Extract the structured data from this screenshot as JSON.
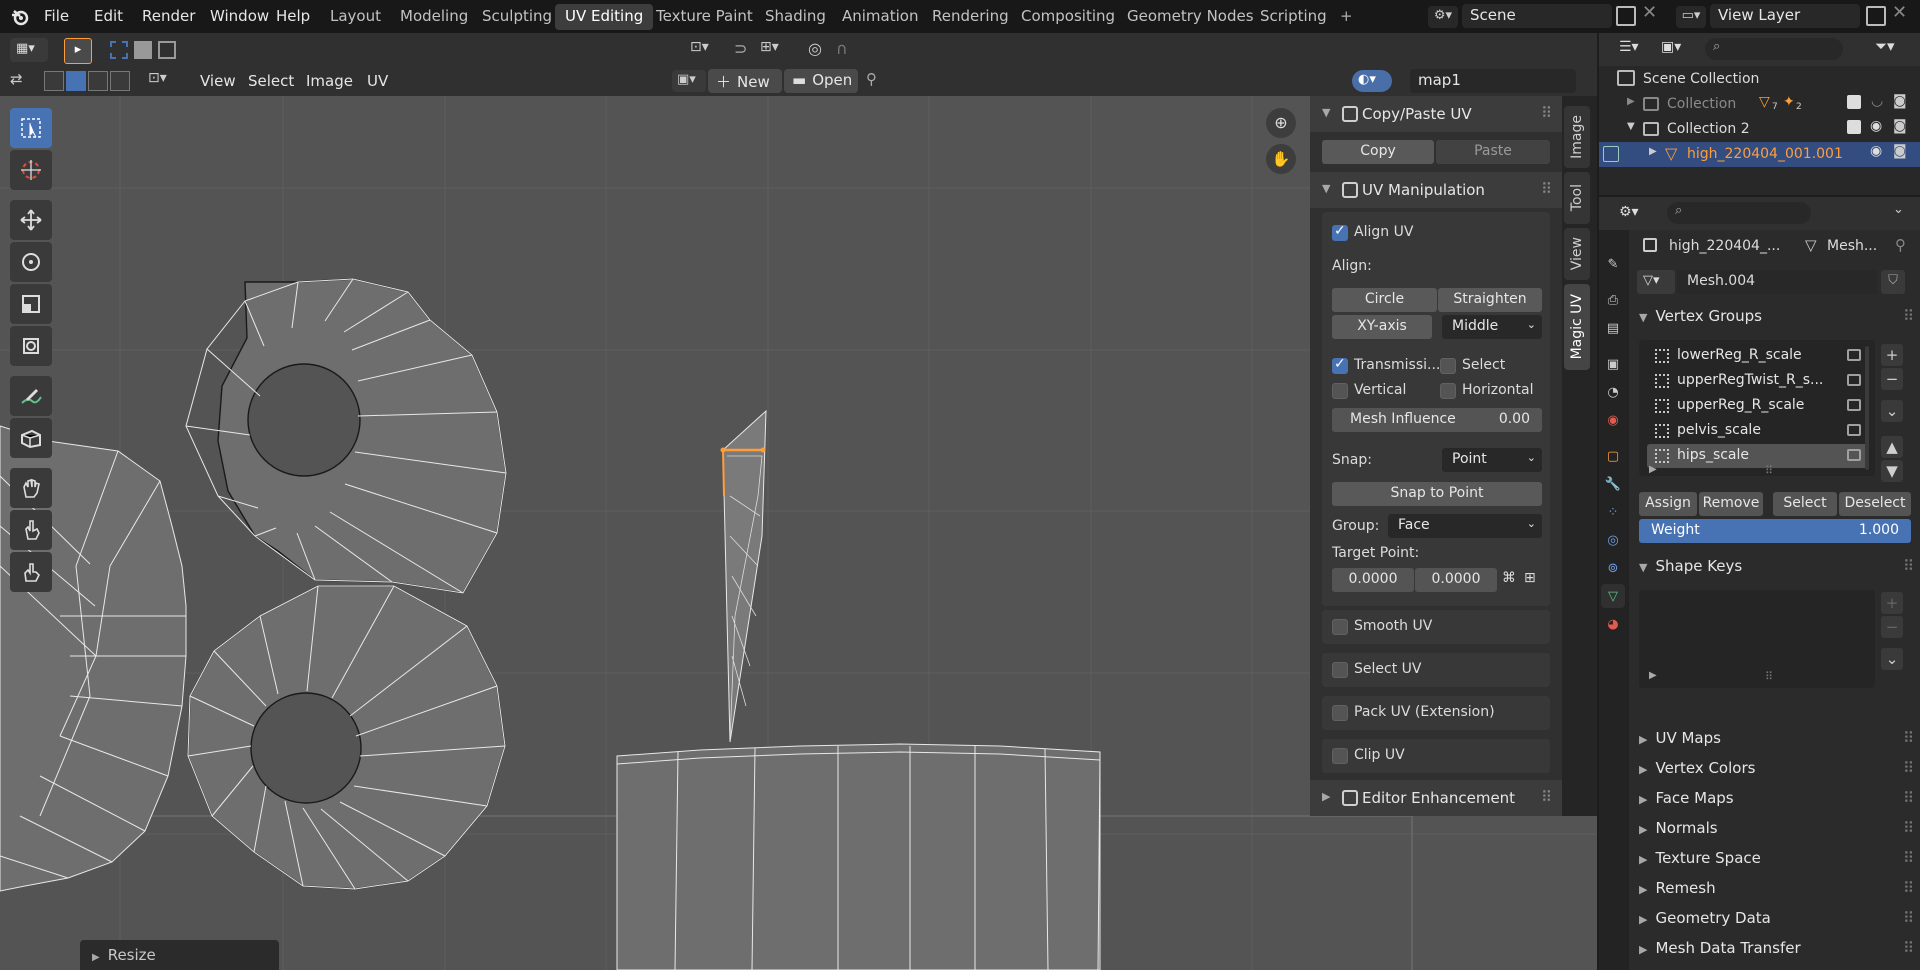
{
  "topbar": {
    "menus": [
      "File",
      "Edit",
      "Render",
      "Window",
      "Help"
    ],
    "workspaces": [
      "Layout",
      "Modeling",
      "Sculpting",
      "UV Editing",
      "Texture Paint",
      "Shading",
      "Animation",
      "Rendering",
      "Compositing",
      "Geometry Nodes",
      "Scripting"
    ],
    "active_workspace": "UV Editing",
    "add_tab": "+",
    "scene": "Scene",
    "view_layer": "View Layer"
  },
  "uv_header": {
    "menus": [
      "View",
      "Select",
      "Image",
      "UV"
    ],
    "new_label": "New",
    "open_label": "Open",
    "uv_map": "map1"
  },
  "npanel": {
    "copy_paste": {
      "title": "Copy/Paste UV",
      "copy": "Copy",
      "paste": "Paste"
    },
    "uv_manipulation": {
      "title": "UV Manipulation",
      "align_uv": "Align UV",
      "align_label": "Align:",
      "circle": "Circle",
      "straighten": "Straighten",
      "xy_axis": "XY-axis",
      "middle": "Middle",
      "transmission": "Transmissi...",
      "select": "Select",
      "vertical": "Vertical",
      "horizontal": "Horizontal",
      "mesh_influence_label": "Mesh Influence",
      "mesh_influence_value": "0.00",
      "snap_label": "Snap:",
      "snap_value": "Point",
      "snap_to_point": "Snap to Point",
      "group_label": "Group:",
      "group_value": "Face",
      "target_point_label": "Target Point:",
      "target_x": "0.0000",
      "target_y": "0.0000"
    },
    "smooth_uv": "Smooth UV",
    "select_uv": "Select UV",
    "pack_uv": "Pack UV (Extension)",
    "clip_uv": "Clip UV",
    "editor_enhancement": "Editor Enhancement"
  },
  "side_tabs": [
    "Image",
    "Tool",
    "View",
    "Magic UV"
  ],
  "active_side_tab": "Magic UV",
  "outliner": {
    "scene_collection": "Scene Collection",
    "collection": "Collection",
    "collection_badge1": "7",
    "collection_badge2": "2",
    "collection2": "Collection 2",
    "object": "high_220404_001.001"
  },
  "properties": {
    "object_name": "high_220404_...",
    "mesh_label": "Mesh...",
    "mesh_name": "Mesh.004",
    "vertex_groups_title": "Vertex Groups",
    "vertex_groups": [
      "lowerReg_R_scale",
      "upperRegTwist_R_s...",
      "upperReg_R_scale",
      "pelvis_scale",
      "hips_scale"
    ],
    "assign": "Assign",
    "remove": "Remove",
    "select": "Select",
    "deselect": "Deselect",
    "weight_label": "Weight",
    "weight_value": "1.000",
    "shape_keys_title": "Shape Keys",
    "sections": [
      "UV Maps",
      "Vertex Colors",
      "Face Maps",
      "Normals",
      "Texture Space",
      "Remesh",
      "Geometry Data",
      "Mesh Data Transfer"
    ]
  },
  "operator_panel": "Resize",
  "colors": {
    "accent": "#4772b3",
    "selected_object": "#ff9d3b",
    "viewport_bg": "#545454"
  }
}
